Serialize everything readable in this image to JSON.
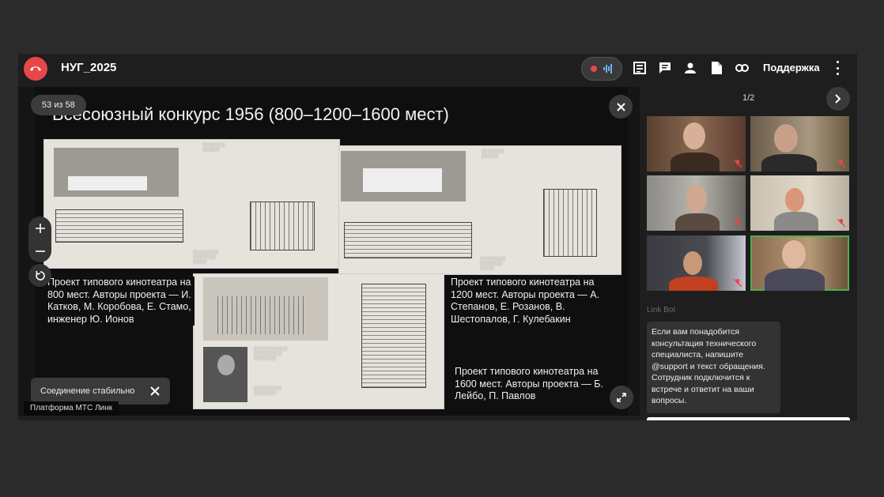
{
  "header": {
    "title": "НУГ_2025",
    "support_label": "Поддержка"
  },
  "slide": {
    "counter": "53 из 58",
    "title": "Всесоюзный конкурс 1956 (800–1200–1600 мест)",
    "captions": {
      "c800": "Проект типового кинотеатра на 800 мест. Авторы проекта — И. Катков, М. Коробова, Е. Стамо, инженер Ю. Ионов",
      "c1200": "Проект типового кинотеатра на 1200 мест. Авторы проекта — А. Степанов, Е. Розанов, В. Шестопалов, Г. Кулебакин",
      "c1600": "Проект типового кинотеатра на 1600 мест. Авторы проекта — Б. Лейбо, П. Павлов"
    }
  },
  "toast": {
    "text": "Соединение стабильно"
  },
  "platform_label": "Платформа МТС Линк",
  "sidebar": {
    "pager": "1/2",
    "bot_name": "Link Bot",
    "bot_message": "Если вам понадобится консультация технического специалиста, напишите @support и текст обращения. Сотрудник подключится к встрече и ответит на ваши вопросы."
  },
  "colors": {
    "hangup": "#e8474a",
    "active_speaker": "#4caf50",
    "mic_muted": "#e8474a"
  },
  "icons": {
    "hangup": "phone-hangup-icon",
    "record": "record-dot-icon",
    "audio": "audio-wave-icon",
    "notes": "notes-icon",
    "chat": "chat-icon",
    "participants": "person-icon",
    "file": "document-icon",
    "link": "link-icon",
    "menu": "kebab-menu-icon"
  }
}
